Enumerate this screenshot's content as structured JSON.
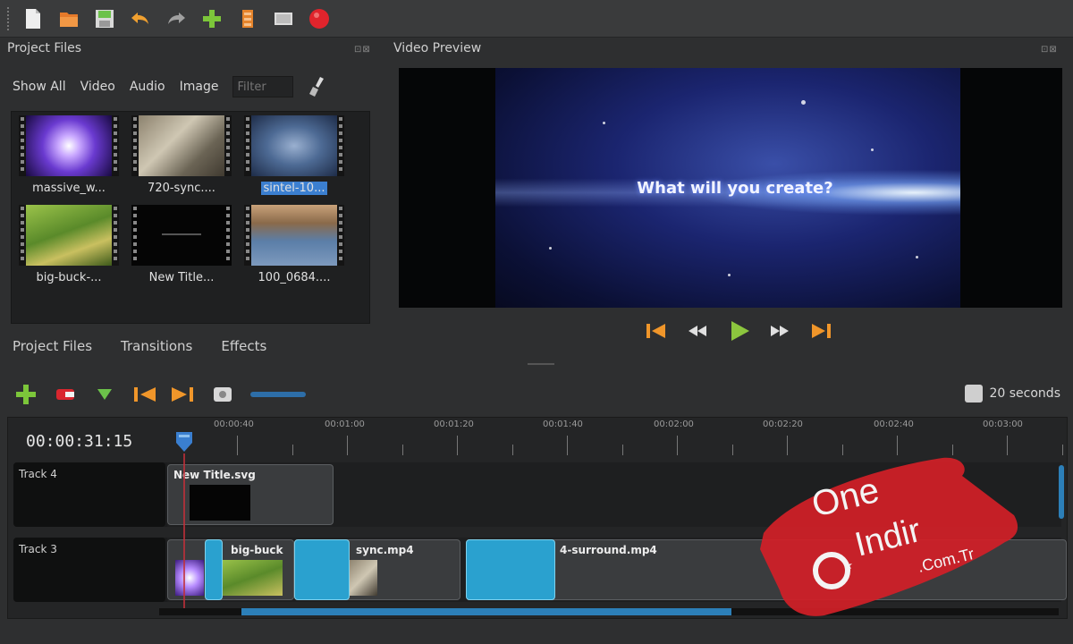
{
  "colors": {
    "accent": "#2c7fb8",
    "clip_transition": "#2aa1cf",
    "record": "#e0242c",
    "selection": "#3b7fd0"
  },
  "toolbar": {
    "icons": [
      "grip-icon",
      "new-project-icon",
      "open-project-icon",
      "save-project-icon",
      "undo-icon",
      "redo-icon",
      "import-files-icon",
      "profile-icon",
      "fullscreen-icon",
      "export-icon"
    ]
  },
  "project_panel": {
    "title": "Project Files",
    "filters": [
      "Show All",
      "Video",
      "Audio",
      "Image"
    ],
    "filter_placeholder": "Filter",
    "files": [
      {
        "name": "massive_w...",
        "selected": false
      },
      {
        "name": "720-sync....",
        "selected": false
      },
      {
        "name": "sintel-10...",
        "selected": true
      },
      {
        "name": "big-buck-...",
        "selected": false
      },
      {
        "name": "New Title...",
        "selected": false
      },
      {
        "name": "100_0684....",
        "selected": false
      }
    ],
    "bottom_tabs": [
      "Project Files",
      "Transitions",
      "Effects"
    ]
  },
  "preview": {
    "title": "Video Preview",
    "overlay_text": "What will you create?",
    "controls": [
      "jump-start-icon",
      "rewind-icon",
      "play-icon",
      "fast-forward-icon",
      "jump-end-icon"
    ]
  },
  "timeline": {
    "timecode": "00:00:31:15",
    "zoom_label": "20 seconds",
    "ruler_labels": [
      "00:00:40",
      "00:01:00",
      "00:01:20",
      "00:01:40",
      "00:02:00",
      "00:02:20",
      "00:02:40",
      "00:03:00"
    ],
    "tracks": [
      {
        "name": "Track 4",
        "clips": [
          {
            "label": "New Title.svg"
          }
        ]
      },
      {
        "name": "Track 3",
        "clips": [
          {
            "label": "big-buck"
          },
          {
            "label": "sync.mp4"
          },
          {
            "label": "4-surround.mp4"
          }
        ]
      }
    ]
  },
  "watermark": {
    "line1": "One",
    "line2": "Indir",
    "line3": ".Com.Tr"
  }
}
